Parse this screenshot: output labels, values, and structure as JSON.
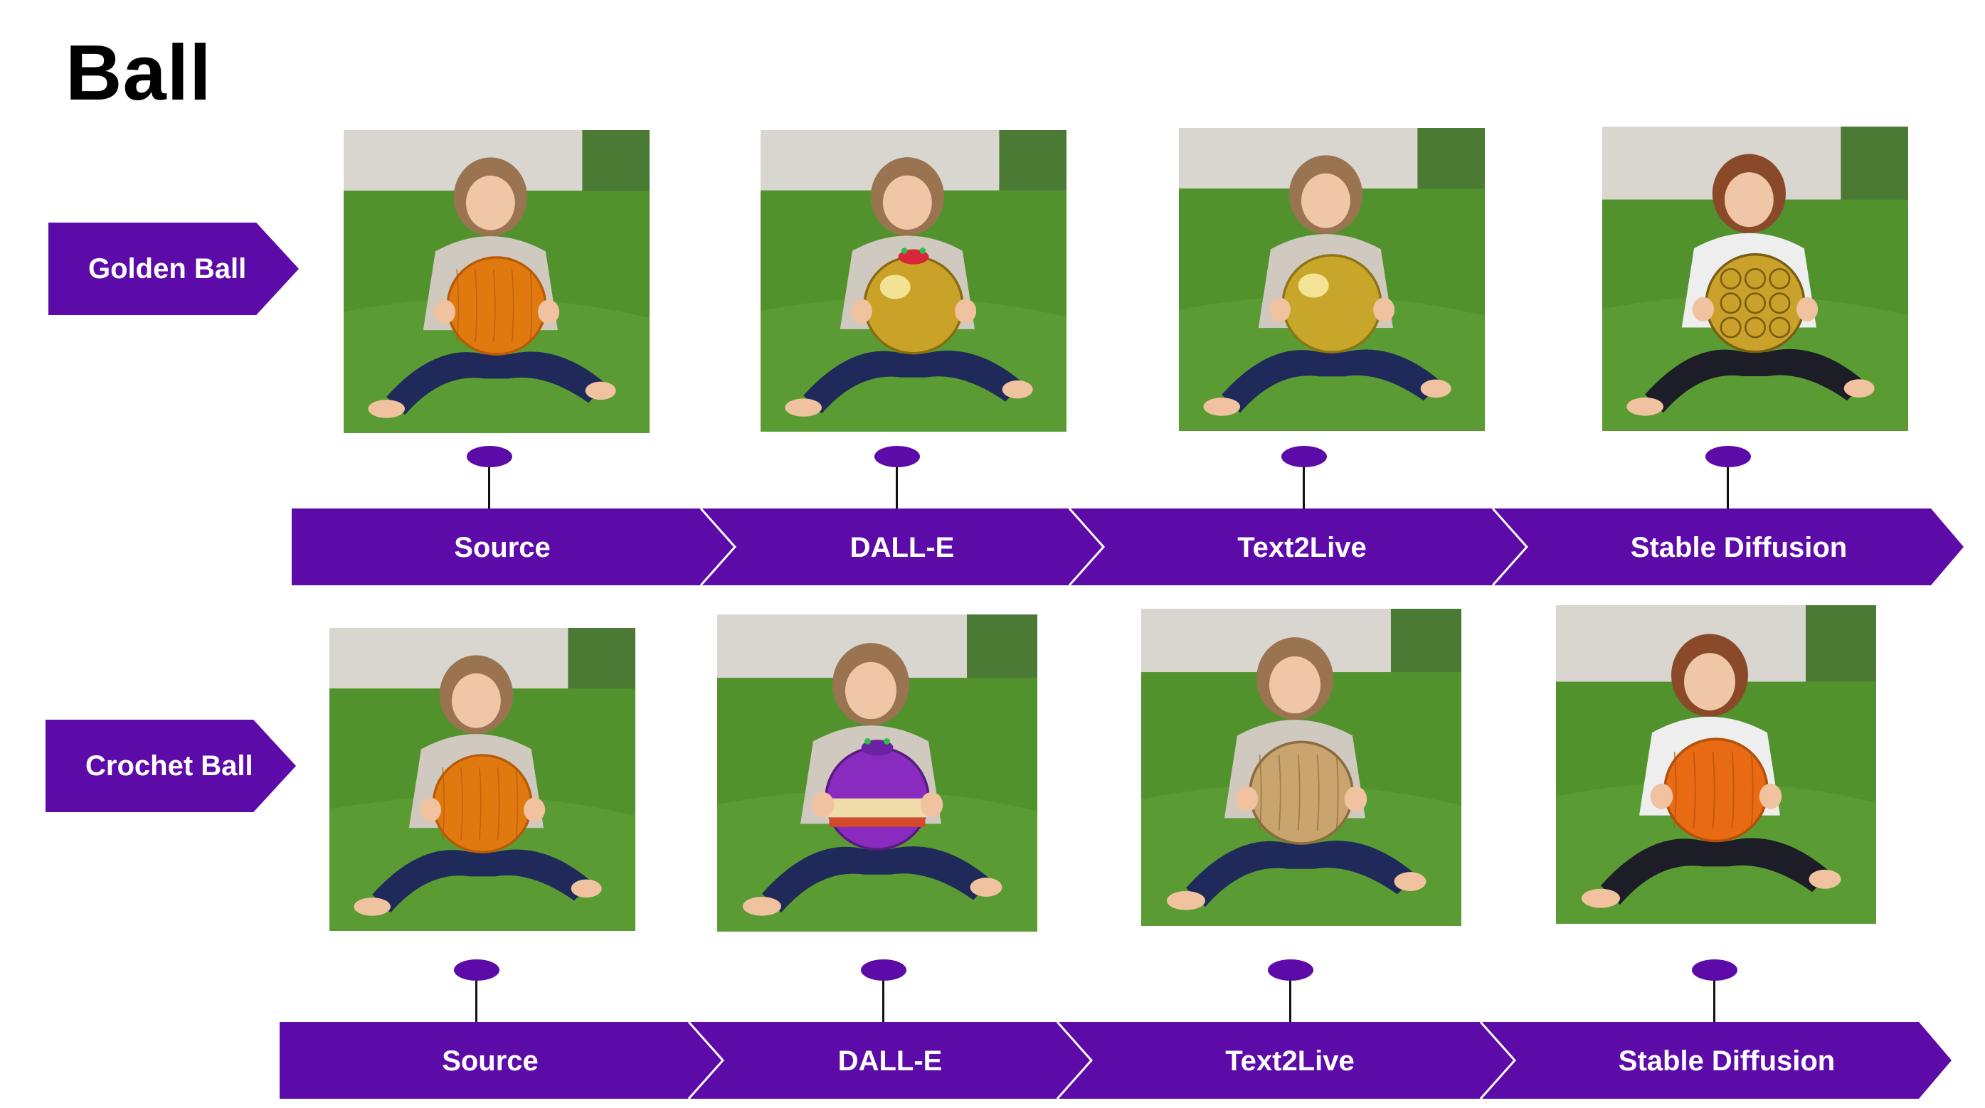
{
  "title": "Ball",
  "colors": {
    "accent": "#5c0aa8",
    "pin": "#5c0aa8",
    "stem": "#111111",
    "text_on_accent": "#ffffff"
  },
  "rows": [
    {
      "label": "Golden Ball",
      "stages": [
        {
          "label": "Source",
          "ball": "orange-felt-ball"
        },
        {
          "label": "DALL-E",
          "ball": "gold-shiny-ball"
        },
        {
          "label": "Text2Live",
          "ball": "gold-foil-ball"
        },
        {
          "label": "Stable Diffusion",
          "ball": "gold-soccer-ball"
        }
      ]
    },
    {
      "label": "Crochet Ball",
      "stages": [
        {
          "label": "Source",
          "ball": "orange-felt-ball"
        },
        {
          "label": "DALL-E",
          "ball": "striped-crochet-ball"
        },
        {
          "label": "Text2Live",
          "ball": "knit-beige-ball"
        },
        {
          "label": "Stable Diffusion",
          "ball": "orange-crochet-ball"
        }
      ]
    }
  ]
}
